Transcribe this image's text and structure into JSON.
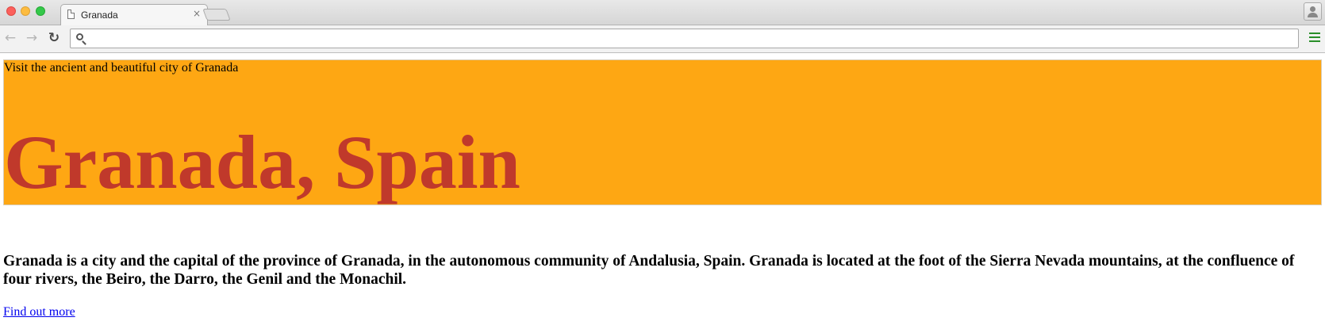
{
  "browser": {
    "tab_title": "Granada",
    "tab_close": "×",
    "address_value": "",
    "icons": {
      "back": "back-arrow-icon",
      "forward": "forward-arrow-icon",
      "reload": "reload-icon",
      "search": "search-icon",
      "menu": "hamburger-menu-icon",
      "profile": "profile-icon",
      "page": "page-document-icon"
    }
  },
  "hero": {
    "tagline": "Visit the ancient and beautiful city of Granada",
    "title": "Granada, Spain",
    "background_color": "#fea713",
    "title_color": "#c0392b"
  },
  "content": {
    "intro": "Granada is a city and the capital of the province of Granada, in the autonomous community of Andalusia, Spain. Granada is located at the foot of the Sierra Nevada mountains, at the confluence of four rivers, the Beiro, the Darro, the Genil and the Monachil.",
    "link_label": "Find out more"
  }
}
